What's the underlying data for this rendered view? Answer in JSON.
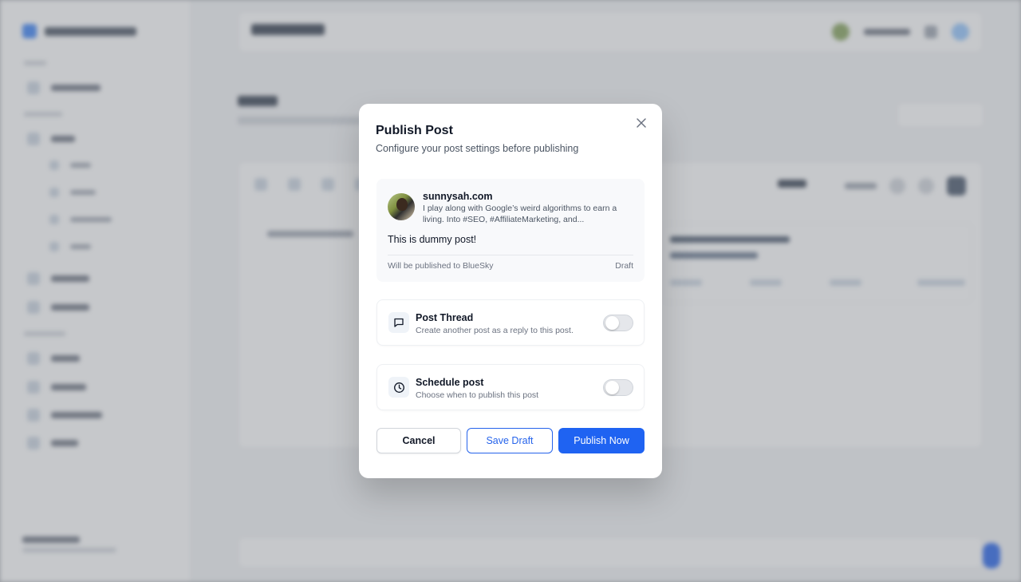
{
  "modal": {
    "title": "Publish Post",
    "description": "Configure your post settings before publishing",
    "close_icon": "close-icon"
  },
  "preview": {
    "account_name": "sunnysah.com",
    "account_bio": "I play along with Google’s weird algorithms to earn a living. Into #SEO, #AffiliateMarketing, and...",
    "post_text": "This is dummy post!",
    "publish_target": "Will be published to BlueSky",
    "status": "Draft"
  },
  "options": {
    "thread": {
      "icon": "message-square-icon",
      "title": "Post Thread",
      "description": "Create another post as a reply to this post.",
      "enabled": false
    },
    "schedule": {
      "icon": "clock-icon",
      "title": "Schedule post",
      "description": "Choose when to publish this post",
      "enabled": false
    }
  },
  "actions": {
    "cancel_label": "Cancel",
    "save_draft_label": "Save Draft",
    "publish_label": "Publish Now"
  },
  "colors": {
    "primary": "#1f63f2",
    "overlay": "rgba(120,124,130,0.42)"
  }
}
